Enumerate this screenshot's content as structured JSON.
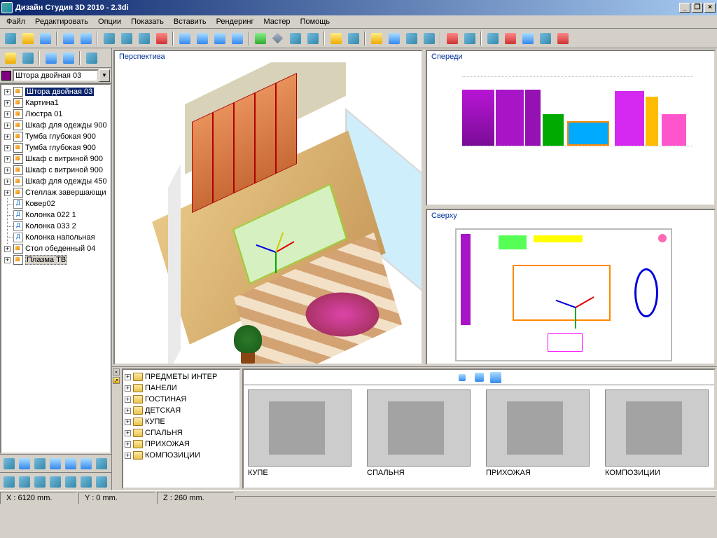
{
  "window": {
    "title": "Дизайн Студия 3D 2010 - 2.3di"
  },
  "menu": {
    "file": "Файл",
    "edit": "Редактировать",
    "options": "Опции",
    "show": "Показать",
    "insert": "Вставить",
    "render": "Рендеринг",
    "master": "Мастер",
    "help": "Помощь"
  },
  "dropdown": {
    "selected": "Штора двойная 03"
  },
  "scene_tree": [
    {
      "exp": "+",
      "icon": "grp",
      "label": "Штора двойная 03",
      "sel": true
    },
    {
      "exp": "+",
      "icon": "grp",
      "label": "Картина1"
    },
    {
      "exp": "+",
      "icon": "grp",
      "label": "Люстра 01"
    },
    {
      "exp": "+",
      "icon": "grp",
      "label": "Шкаф для одежды 900"
    },
    {
      "exp": "+",
      "icon": "grp",
      "label": "Тумба глубокая 900"
    },
    {
      "exp": "+",
      "icon": "grp",
      "label": "Тумба глубокая 900"
    },
    {
      "exp": "+",
      "icon": "grp",
      "label": "Шкаф с витриной 900"
    },
    {
      "exp": "+",
      "icon": "grp",
      "label": "Шкаф с витриной 900"
    },
    {
      "exp": "+",
      "icon": "grp",
      "label": "Шкаф для одежды 450"
    },
    {
      "exp": "+",
      "icon": "grp",
      "label": "Стеллаж завершающи"
    },
    {
      "exp": "",
      "icon": "d",
      "label": "Ковер02"
    },
    {
      "exp": "",
      "icon": "d",
      "label": "Колонка 022 1"
    },
    {
      "exp": "",
      "icon": "d",
      "label": "Колонка 033 2"
    },
    {
      "exp": "",
      "icon": "d",
      "label": "Колонка напольная"
    },
    {
      "exp": "+",
      "icon": "grp",
      "label": "Стол обеденный 04"
    },
    {
      "exp": "+",
      "icon": "grp",
      "label": "Плазма ТВ",
      "sel2": true
    }
  ],
  "views": {
    "perspective": "Перспектива",
    "front": "Спереди",
    "top": "Сверху"
  },
  "library_tree": [
    {
      "label": "ПРЕДМЕТЫ ИНТЕР"
    },
    {
      "label": "ПАНЕЛИ"
    },
    {
      "label": "ГОСТИНАЯ"
    },
    {
      "label": "ДЕТСКАЯ"
    },
    {
      "label": "КУПЕ"
    },
    {
      "label": "СПАЛЬНЯ"
    },
    {
      "label": "ПРИХОЖАЯ"
    },
    {
      "label": "КОМПОЗИЦИИ"
    }
  ],
  "thumbs": [
    {
      "label": "КУПЕ",
      "cls": "th-cab"
    },
    {
      "label": "СПАЛЬНЯ",
      "cls": "th-bed"
    },
    {
      "label": "ПРИХОЖАЯ",
      "cls": "th-hal"
    },
    {
      "label": "КОМПОЗИЦИИ",
      "cls": "th-com"
    }
  ],
  "status": {
    "x": "X : 6120 mm.",
    "y": "Y : 0 mm.",
    "z": "Z : 260 mm."
  }
}
